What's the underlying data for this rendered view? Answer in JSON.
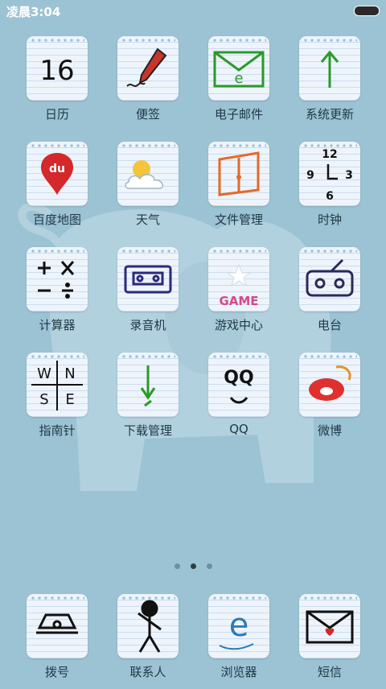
{
  "status_bar": {
    "time": "凌晨3:04"
  },
  "apps": {
    "calendar": {
      "label": "日历",
      "day": "16"
    },
    "notes": {
      "label": "便签"
    },
    "email": {
      "label": "电子邮件",
      "mark": "e"
    },
    "system_update": {
      "label": "系统更新"
    },
    "baidu_map": {
      "label": "百度地图",
      "logo_text": "du"
    },
    "weather": {
      "label": "天气"
    },
    "file_manager": {
      "label": "文件管理"
    },
    "clock": {
      "label": "时钟",
      "digits": [
        "12",
        "9",
        "3",
        "6"
      ]
    },
    "calculator": {
      "label": "计算器"
    },
    "recorder": {
      "label": "录音机"
    },
    "game_center": {
      "label": "游戏中心",
      "logo_text": "GAME"
    },
    "radio": {
      "label": "电台"
    },
    "compass": {
      "label": "指南针",
      "letters": [
        "W",
        "N",
        "S",
        "E"
      ]
    },
    "download_manager": {
      "label": "下载管理"
    },
    "qq": {
      "label": "QQ",
      "logo_text": "QQ"
    },
    "weibo": {
      "label": "微博"
    }
  },
  "page_indicator": {
    "count": 3,
    "active_index": 1
  },
  "dock": {
    "dialer": {
      "label": "拨号"
    },
    "contacts": {
      "label": "联系人"
    },
    "browser": {
      "label": "浏览器",
      "mark": "e"
    },
    "messages": {
      "label": "短信"
    }
  },
  "colors": {
    "background": "#9cc3d4",
    "tile": "#eef4fb",
    "label": "#1f3844",
    "accent_red": "#d4282a",
    "accent_green": "#2a9a2a"
  }
}
